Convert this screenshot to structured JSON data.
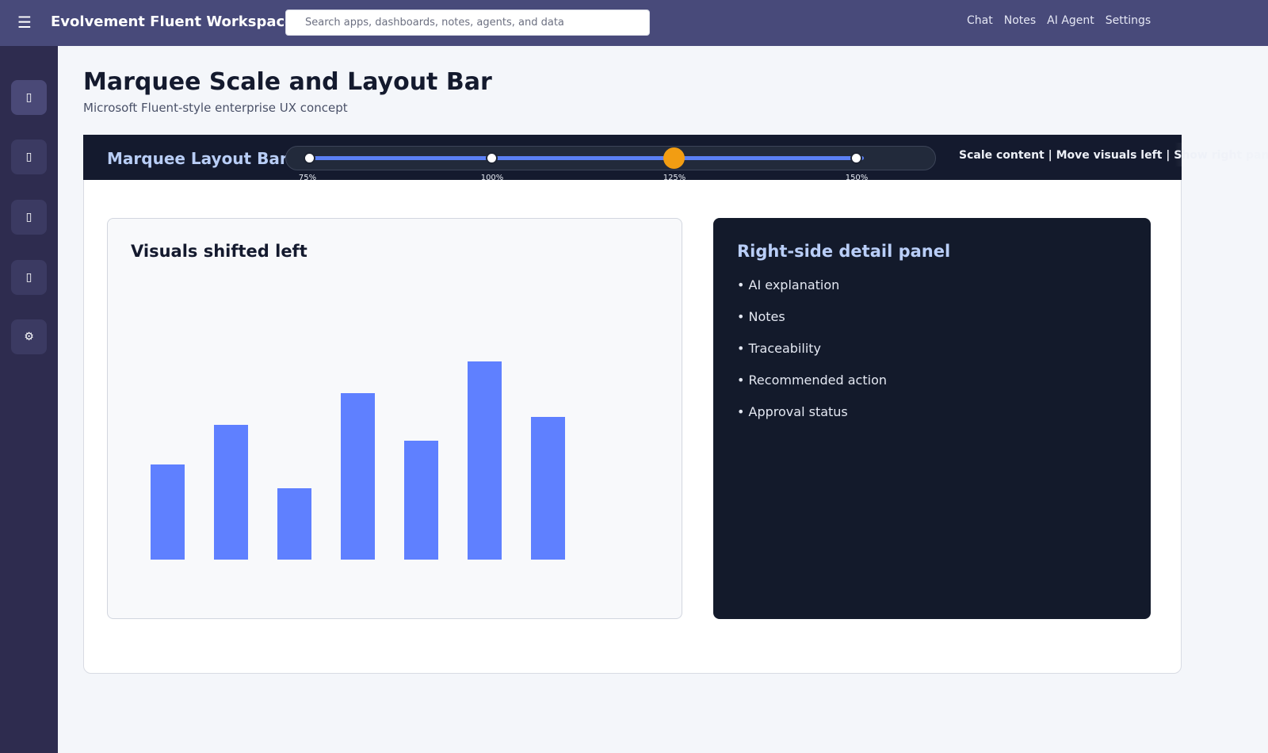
{
  "header": {
    "menu_icon": "hamburger-icon",
    "app_title": "Evolvement Fluent Workspace",
    "search_placeholder": "Search apps, dashboards, notes, agents, and data",
    "nav": [
      "Chat",
      "Notes",
      "AI Agent",
      "Settings"
    ]
  },
  "rail": {
    "buttons": [
      {
        "icon": "home-icon",
        "glyph": "▯"
      },
      {
        "icon": "dashboard-icon",
        "glyph": "▯"
      },
      {
        "icon": "notes-icon",
        "glyph": "▯"
      },
      {
        "icon": "agent-icon",
        "glyph": "▯"
      },
      {
        "icon": "gear-icon",
        "glyph": "⚙"
      }
    ]
  },
  "page": {
    "title": "Marquee Scale and Layout Bar",
    "subtitle": "Microsoft Fluent-style enterprise UX concept"
  },
  "marquee": {
    "label": "Marquee Layout Bar",
    "scale_options": [
      "75%",
      "100%",
      "125%",
      "150%"
    ],
    "selected_scale": "125%",
    "actions_text": "Scale content | Move visuals left | Show right panel"
  },
  "visual_panel": {
    "title": "Visuals shifted left"
  },
  "chart_data": {
    "type": "bar",
    "values": [
      12,
      17,
      9,
      21,
      15,
      25,
      18
    ],
    "ylim": [
      0,
      35
    ],
    "color": "#5f80ff"
  },
  "detail_panel": {
    "title": "Right-side detail panel",
    "items": [
      "• AI explanation",
      "• Notes",
      "• Traceability",
      "• Recommended action",
      "• Approval status"
    ]
  },
  "colors": {
    "topbar": "#484a7a",
    "rail": "#2e2c4f",
    "marquee": "#141a2e",
    "accent": "#5b80f5",
    "selected_stop": "#f29d12"
  }
}
